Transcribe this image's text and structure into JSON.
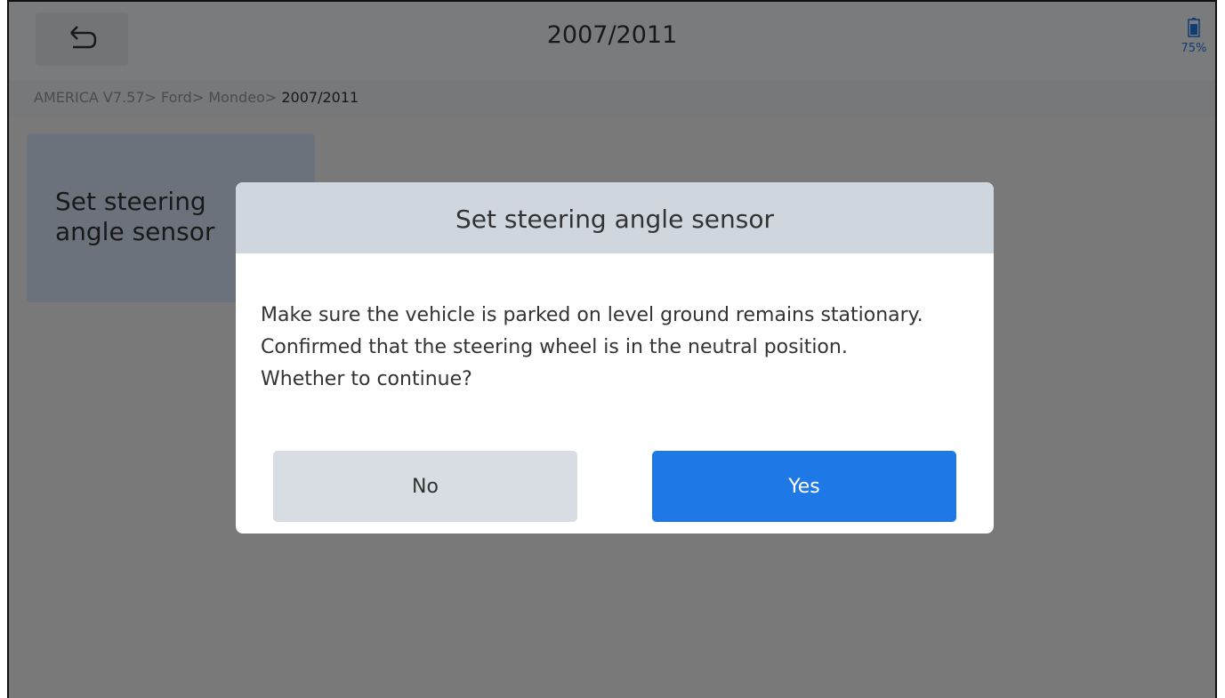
{
  "header": {
    "title": "2007/2011",
    "battery_percent": "75%"
  },
  "breadcrumb": {
    "path": "AMERICA V7.57> Ford> Mondeo> ",
    "current": "2007/2011"
  },
  "menu": {
    "tile_line1": "Set steering",
    "tile_line2": "angle sensor"
  },
  "dialog": {
    "title": "Set steering angle sensor",
    "lines": [
      "Make sure the vehicle is parked on level ground remains stationary.",
      "Confirmed that the steering wheel is in the neutral position.",
      "Whether to continue?"
    ],
    "no_label": "No",
    "yes_label": "Yes"
  },
  "icons": {
    "back": "back-arrow-icon",
    "battery": "battery-icon"
  },
  "colors": {
    "accent": "#1e78e6",
    "dialog_header": "#cfd6de"
  }
}
